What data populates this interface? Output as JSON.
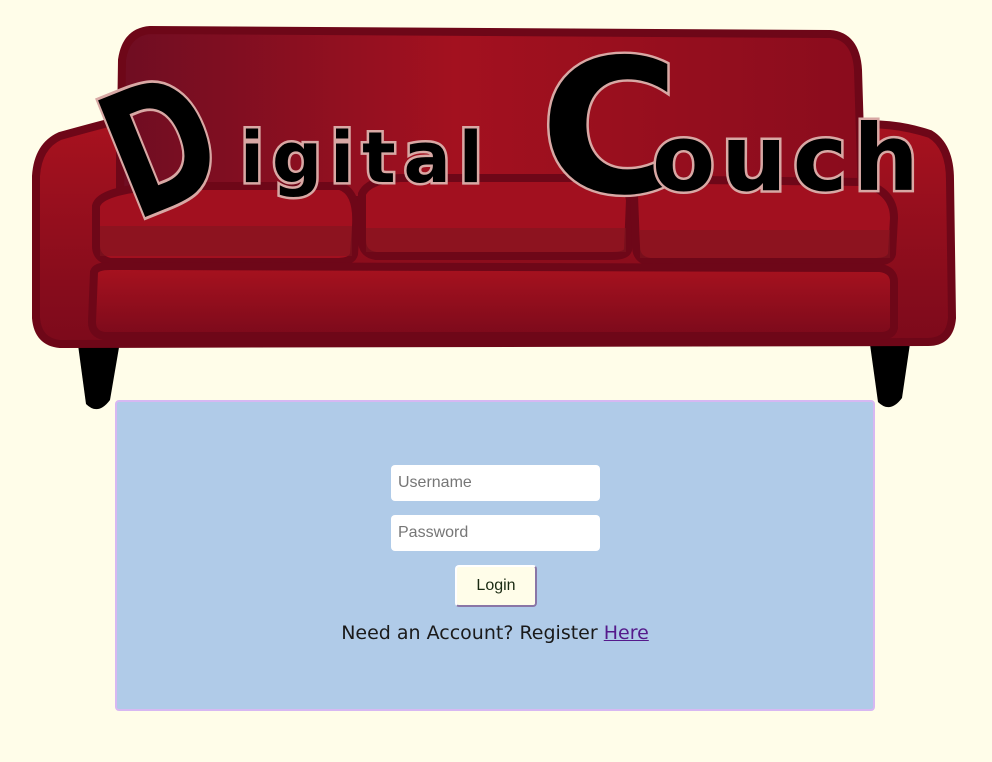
{
  "brand": {
    "first_word_initial": "D",
    "first_word_rest": "igital",
    "second_word_initial": "C",
    "second_word_rest": "ouch",
    "sofa_color": "#9c0f22",
    "letter_fill": "#000000",
    "letter_outline": "#d8a8a4"
  },
  "login_form": {
    "username_placeholder": "Username",
    "password_placeholder": "Password",
    "login_label": "Login",
    "register_prompt": "Need an Account? Register ",
    "register_link_label": "Here"
  },
  "colors": {
    "page_background": "#fffde9",
    "panel_background": "#b0cbe8",
    "panel_border": "#d7b8f2",
    "link_color": "#551a8b"
  }
}
